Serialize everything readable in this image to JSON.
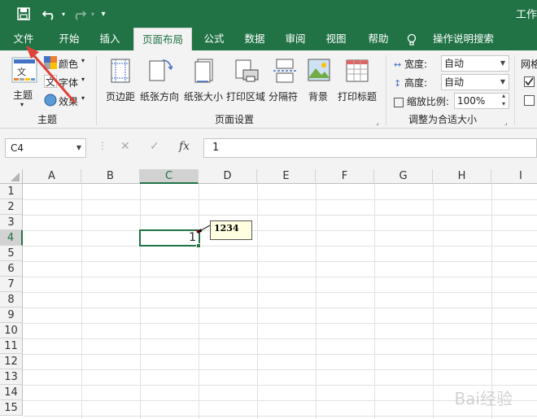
{
  "titlebar": {
    "title": "工作",
    "undo_icon": "undo-icon",
    "redo_icon": "redo-icon",
    "save_icon": "save-icon",
    "customize_icon": "customize-icon"
  },
  "tabs": [
    {
      "label": "文件",
      "active": false
    },
    {
      "label": "开始",
      "active": false
    },
    {
      "label": "插入",
      "active": false
    },
    {
      "label": "页面布局",
      "active": true
    },
    {
      "label": "公式",
      "active": false
    },
    {
      "label": "数据",
      "active": false
    },
    {
      "label": "审阅",
      "active": false
    },
    {
      "label": "视图",
      "active": false
    },
    {
      "label": "帮助",
      "active": false
    }
  ],
  "tell_me": {
    "label": "操作说明搜索",
    "icon": "lightbulb-icon"
  },
  "ribbon": {
    "themes": {
      "group_label": "主题",
      "themes_label": "主题",
      "colors_label": "颜色",
      "fonts_label": "字体",
      "effects_label": "效果"
    },
    "page_setup": {
      "group_label": "页面设置",
      "margins": "页边距",
      "orientation": "纸张方向",
      "size": "纸张大小",
      "print_area": "打印区域",
      "breaks": "分隔符",
      "background": "背景",
      "print_titles": "打印标题"
    },
    "scale_to_fit": {
      "group_label": "调整为合适大小",
      "width_label": "宽度:",
      "width_value": "自动",
      "height_label": "高度:",
      "height_value": "自动",
      "scale_label": "缩放比例:",
      "scale_value": "100%"
    },
    "sheet_options": {
      "gridlines_label": "网格"
    }
  },
  "formula_bar": {
    "name_box": "C4",
    "cancel": "✕",
    "enter": "✓",
    "fx": "fx",
    "value": "1"
  },
  "sheet": {
    "columns": [
      "A",
      "B",
      "C",
      "D",
      "E",
      "F",
      "G",
      "H",
      "I"
    ],
    "rows": [
      "1",
      "2",
      "3",
      "4",
      "5",
      "6",
      "7",
      "8",
      "9",
      "10",
      "11",
      "12",
      "13",
      "14",
      "15"
    ],
    "selected_column": "C",
    "selected_row": "4",
    "active_cell_value": "1",
    "comment_text": "1234"
  },
  "watermark": "Bai经验"
}
